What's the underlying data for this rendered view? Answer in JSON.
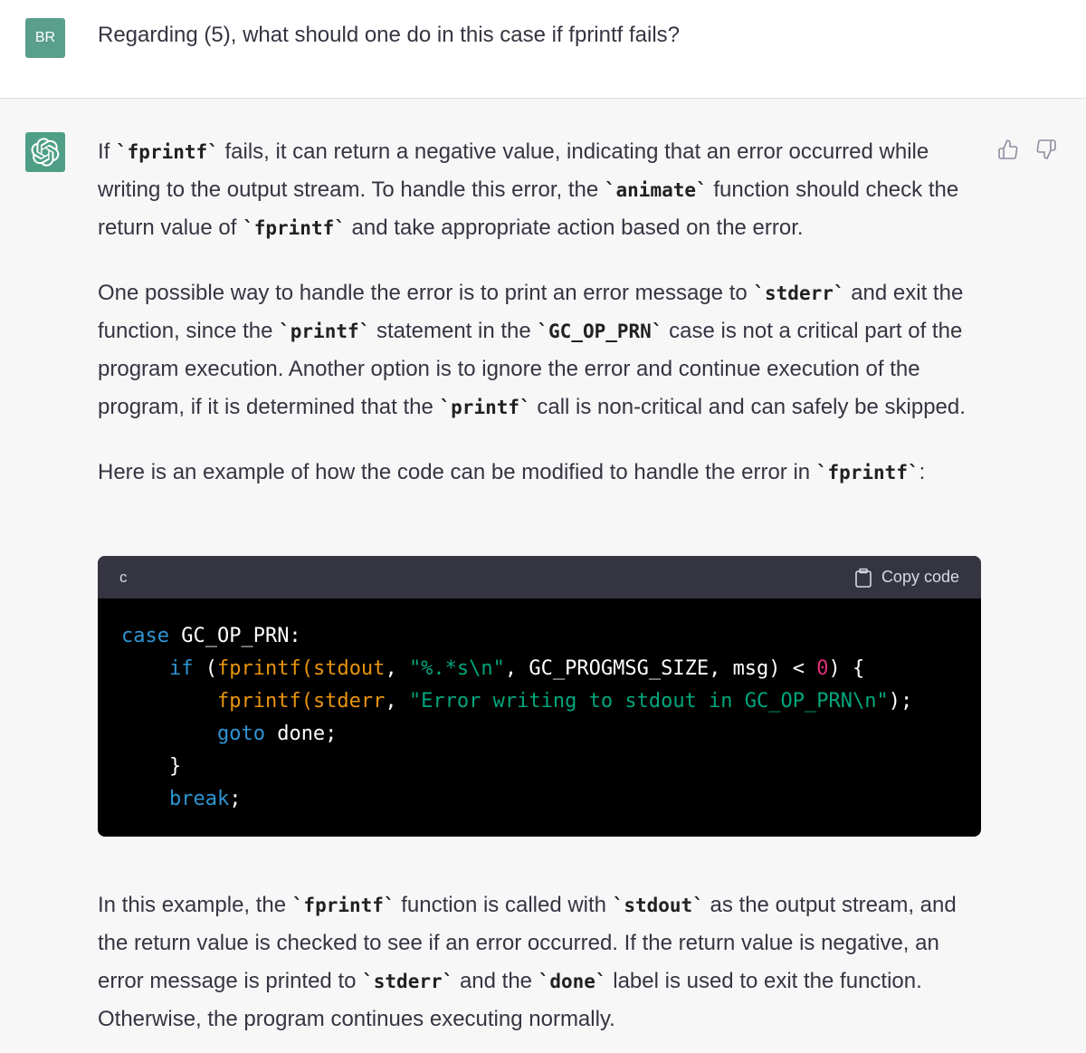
{
  "user": {
    "avatar_initials": "BR",
    "message": "Regarding (5), what should one do in this case if fprintf fails?"
  },
  "assistant": {
    "avatar_icon": "openai-logo-icon",
    "para1": {
      "t1": "If ",
      "c1": "`fprintf`",
      "t2": " fails, it can return a negative value, indicating that an error occurred while writing to the output stream. To handle this error, the ",
      "c2": "`animate`",
      "t3": " function should check the return value of ",
      "c3": "`fprintf`",
      "t4": " and take appropriate action based on the error."
    },
    "para2": {
      "t1": "One possible way to handle the error is to print an error message to ",
      "c1": "`stderr`",
      "t2": " and exit the function, since the ",
      "c2": "`printf`",
      "t3": " statement in the ",
      "c3": "`GC_OP_PRN`",
      "t4": " case is not a critical part of the program execution. Another option is to ignore the error and continue execution of the program, if it is determined that the ",
      "c4": "`printf`",
      "t5": " call is non-critical and can safely be skipped."
    },
    "para3": {
      "t1": "Here is an example of how the code can be modified to handle the error in ",
      "c1": "`fprintf`",
      "t2": ":"
    },
    "code": {
      "language": "c",
      "copy_label": "Copy code",
      "line1": {
        "kw": "case",
        "rest": " GC_OP_PRN:"
      },
      "line2": {
        "indent": "    ",
        "kw": "if",
        "p1": " (",
        "fn": "fprintf",
        "p2": "(",
        "arg1": "stdout",
        "p3": ", ",
        "str": "\"%.*s\\n\"",
        "p4": ", GC_PROGMSG_SIZE, msg) < ",
        "num": "0",
        "p5": ") {"
      },
      "line3": {
        "indent": "        ",
        "fn": "fprintf",
        "p1": "(",
        "arg1": "stderr",
        "p2": ", ",
        "str": "\"Error writing to stdout in GC_OP_PRN\\n\"",
        "p3": ");"
      },
      "line4": {
        "indent": "        ",
        "kw": "goto",
        "rest": " done;"
      },
      "line5": {
        "indent": "    ",
        "rest": "}"
      },
      "line6": {
        "indent": "    ",
        "kw": "break",
        "rest": ";"
      }
    },
    "para4": {
      "t1": "In this example, the ",
      "c1": "`fprintf`",
      "t2": " function is called with ",
      "c2": "`stdout`",
      "t3": " as the output stream, and the return value is checked to see if an error occurred. If the return value is negative, an error message is printed to ",
      "c3": "`stderr`",
      "t4": " and the ",
      "c4": "`done`",
      "t5": " label is used to exit the function. Otherwise, the program continues executing normally."
    },
    "feedback": {
      "up_icon": "thumbs-up-icon",
      "down_icon": "thumbs-down-icon"
    }
  }
}
